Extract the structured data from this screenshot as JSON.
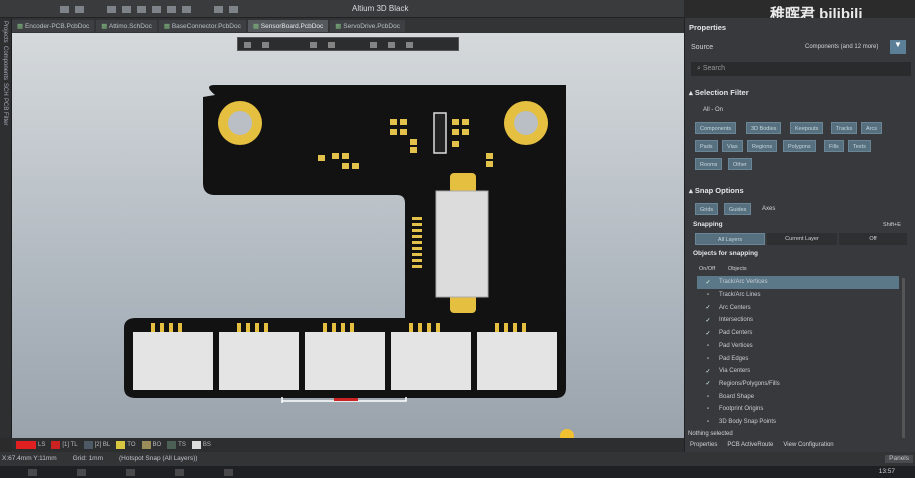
{
  "app_title": "Altium 3D Black",
  "tabs": [
    "Encoder-PCB.PcbDoc",
    "Attimo.SchDoc",
    "BaseConnector.PcbDoc",
    "SensorBoard.PcbDoc",
    "ServoDrive.PcbDoc"
  ],
  "active_tab": 3,
  "left_panels": [
    "Projects",
    "Components",
    "SCH",
    "PCB Filter"
  ],
  "watermark": "稚晖君 bilibili",
  "panel": {
    "title": "Properties",
    "source_label": "Source",
    "source_value": "Components (and 12 more)",
    "search_placeholder": "Search",
    "selection_filter": {
      "title": "Selection Filter",
      "all_label": "All - On",
      "buttons": [
        "Components",
        "3D Bodies",
        "Keepouts",
        "Tracks",
        "Arcs",
        "Pads",
        "Vias",
        "Regions",
        "Polygons",
        "Fills",
        "Texts",
        "Rooms",
        "Other"
      ]
    },
    "snap_options": {
      "title": "Snap Options",
      "grid_buttons": [
        "Grids",
        "Guides",
        "Axes"
      ],
      "snapping_label": "Snapping",
      "snapping_hint": "Shift+E",
      "modes": [
        "All Layers",
        "Current Layer",
        "Off"
      ],
      "objects_title": "Objects for snapping",
      "col_onoff": "On/Off",
      "col_objects": "Objects",
      "objects": [
        {
          "name": "Track/Arc Vertices",
          "on": true
        },
        {
          "name": "Track/Arc Lines",
          "on": false
        },
        {
          "name": "Arc Centers",
          "on": true
        },
        {
          "name": "Intersections",
          "on": true
        },
        {
          "name": "Pad Centers",
          "on": true
        },
        {
          "name": "Pad Vertices",
          "on": false
        },
        {
          "name": "Pad Edges",
          "on": false
        },
        {
          "name": "Via Centers",
          "on": true
        },
        {
          "name": "Regions/Polygons/Fills",
          "on": true
        },
        {
          "name": "Board Shape",
          "on": false
        },
        {
          "name": "Footprint Origins",
          "on": false
        },
        {
          "name": "3D Body Snap Points",
          "on": false
        }
      ]
    },
    "nothing_selected": "Nothing selected",
    "bottom_tabs": [
      "Properties",
      "PCB ActiveRoute",
      "View Configuration"
    ],
    "panels_button": "Panels"
  },
  "layers": [
    {
      "name": "LS",
      "color": "#e02020"
    },
    {
      "name": "[1] TL",
      "color": "#cc2222"
    },
    {
      "name": "[2] BL",
      "color": "#4d5a66"
    },
    {
      "name": "TO",
      "color": "#d8c640"
    },
    {
      "name": "BO",
      "color": "#9a8d5a"
    },
    {
      "name": "TS",
      "color": "#4b5f55"
    },
    {
      "name": "BS",
      "color": "#dddddd"
    }
  ],
  "status": {
    "coords": "X:67.4mm Y:11mm",
    "grid": "Grid: 1mm",
    "snap": "(Hotspot Snap (All Layers))",
    "time": "13:57"
  }
}
